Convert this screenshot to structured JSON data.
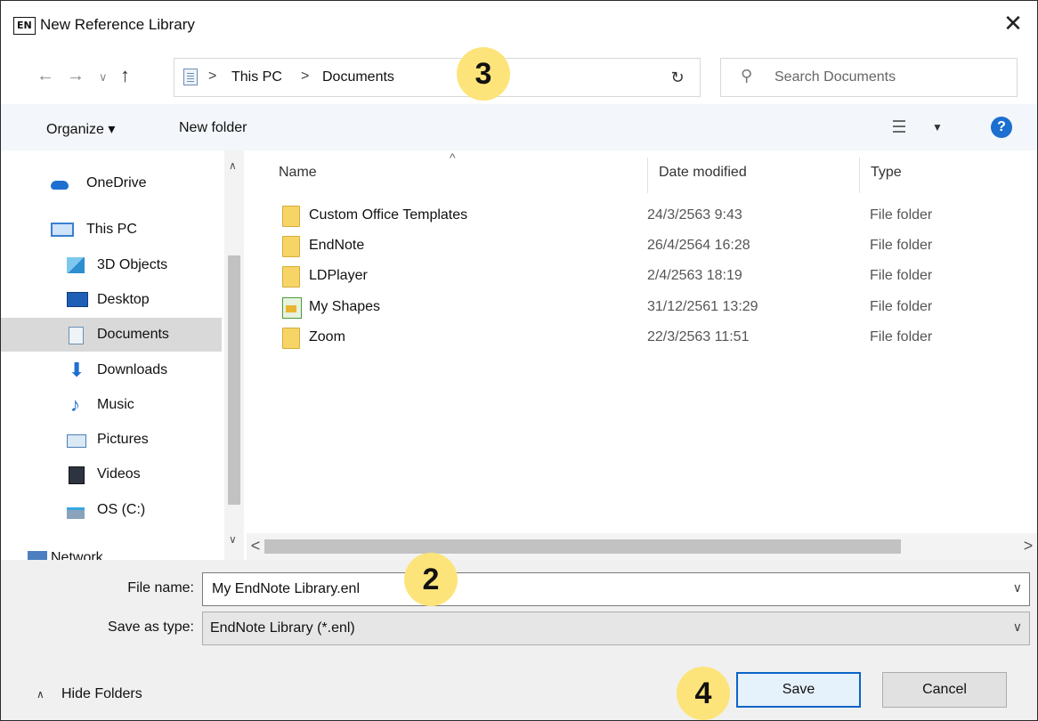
{
  "window": {
    "app_logo": "EN",
    "title": "New Reference Library",
    "close_glyph": "✕"
  },
  "address": {
    "back_glyph": "←",
    "forward_glyph": "→",
    "recent_glyph": "∨",
    "up_glyph": "↑",
    "crumbs": [
      "This PC",
      "Documents"
    ],
    "separator": ">",
    "dropdown_glyph": "∨",
    "refresh_glyph": "↻",
    "search_glyph": "⚲",
    "search_placeholder": "Search Documents"
  },
  "toolbar": {
    "organize_label": "Organize ▾",
    "new_folder_label": "New folder",
    "view_caret": "▼",
    "help_glyph": "?"
  },
  "nav_pane": {
    "scroll_up": "∧",
    "scroll_down": "∨",
    "items": [
      {
        "label": "OneDrive",
        "icon": "onedrive-icon"
      },
      {
        "label": "This PC",
        "icon": "pc-icon"
      },
      {
        "label": "3D Objects",
        "icon": "3d-objects-icon"
      },
      {
        "label": "Desktop",
        "icon": "desktop-icon"
      },
      {
        "label": "Documents",
        "icon": "documents-icon",
        "selected": true
      },
      {
        "label": "Downloads",
        "icon": "downloads-icon"
      },
      {
        "label": "Music",
        "icon": "music-icon"
      },
      {
        "label": "Pictures",
        "icon": "pictures-icon"
      },
      {
        "label": "Videos",
        "icon": "videos-icon"
      },
      {
        "label": "OS (C:)",
        "icon": "drive-icon"
      }
    ],
    "partial_item": "Network"
  },
  "file_list": {
    "sort_caret": "^",
    "columns": {
      "name": "Name",
      "date": "Date modified",
      "type": "Type"
    },
    "rows": [
      {
        "name": "Custom Office Templates",
        "date": "24/3/2563 9:43",
        "type": "File folder",
        "icon": "folder-icon"
      },
      {
        "name": "EndNote",
        "date": "26/4/2564 16:28",
        "type": "File folder",
        "icon": "folder-icon"
      },
      {
        "name": "LDPlayer",
        "date": "2/4/2563 18:19",
        "type": "File folder",
        "icon": "folder-icon"
      },
      {
        "name": "My Shapes",
        "date": "31/12/2561 13:29",
        "type": "File folder",
        "icon": "shapes-folder-icon"
      },
      {
        "name": "Zoom",
        "date": "22/3/2563 11:51",
        "type": "File folder",
        "icon": "folder-icon"
      }
    ],
    "hscroll_left": "<",
    "hscroll_right": ">"
  },
  "form": {
    "file_name_label": "File name:",
    "file_name_value": "My EndNote Library.enl",
    "save_type_label": "Save as type:",
    "save_type_value": "EndNote Library (*.enl)",
    "dropdown_glyph": "∨",
    "hide_folders_caret": "∧",
    "hide_folders_label": "Hide Folders",
    "save_label": "Save",
    "cancel_label": "Cancel"
  },
  "annotations": {
    "badge_address": "3",
    "badge_filename": "2",
    "badge_save": "4"
  },
  "colors": {
    "accent": "#0a64c8",
    "badge": "#fde47a",
    "selected_row": "#d9d9d9",
    "folder": "#f6d466"
  }
}
